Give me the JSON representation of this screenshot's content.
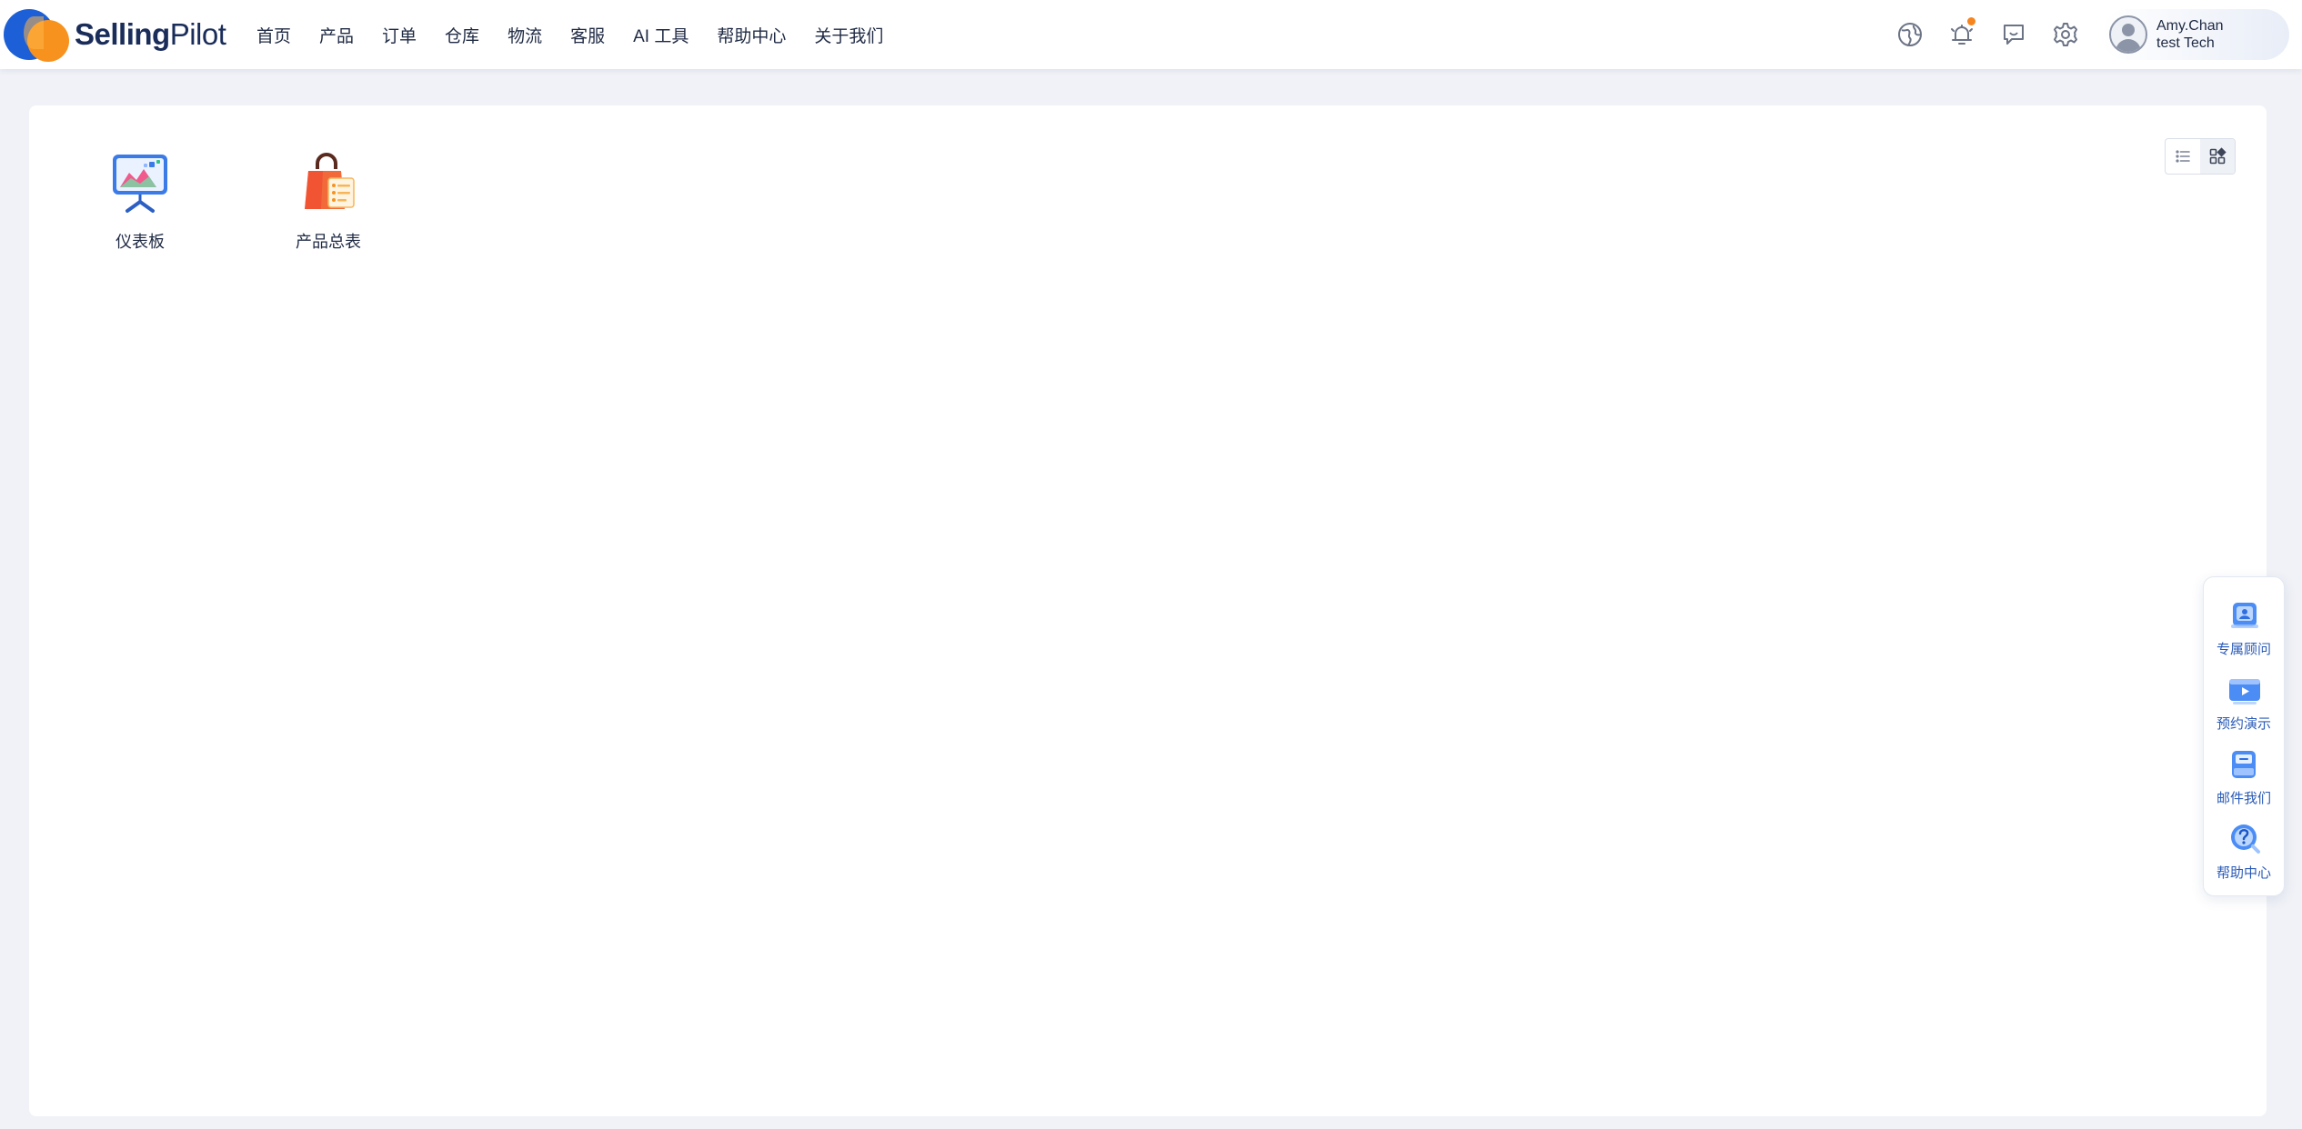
{
  "brand": {
    "bold": "Selling",
    "thin": "Pilot"
  },
  "nav": {
    "items": [
      {
        "label": "首页"
      },
      {
        "label": "产品"
      },
      {
        "label": "订单"
      },
      {
        "label": "仓库"
      },
      {
        "label": "物流"
      },
      {
        "label": "客服"
      },
      {
        "label": "AI 工具"
      },
      {
        "label": "帮助中心"
      },
      {
        "label": "关于我们"
      }
    ]
  },
  "header_tools": [
    {
      "icon": "globe-icon"
    },
    {
      "icon": "bell-icon",
      "has_notification": true
    },
    {
      "icon": "message-icon"
    },
    {
      "icon": "gear-icon"
    }
  ],
  "user": {
    "name": "Amy.Chan",
    "company": "test Tech"
  },
  "apps": [
    {
      "label": "仪表板",
      "icon": "dashboard-icon"
    },
    {
      "label": "产品总表",
      "icon": "shopping-bag-icon"
    }
  ],
  "view_toggle": {
    "active": "grid",
    "options": [
      "list",
      "grid"
    ]
  },
  "side_float": [
    {
      "label": "专属顾问",
      "icon": "advisor-icon"
    },
    {
      "label": "预约演示",
      "icon": "demo-icon"
    },
    {
      "label": "邮件我们",
      "icon": "mail-icon"
    },
    {
      "label": "帮助中心",
      "icon": "help-icon"
    }
  ],
  "colors": {
    "brand_blue": "#1c5fd6",
    "brand_orange": "#f7921e",
    "notification": "#f7851e",
    "side_label": "#2a5bb8"
  }
}
